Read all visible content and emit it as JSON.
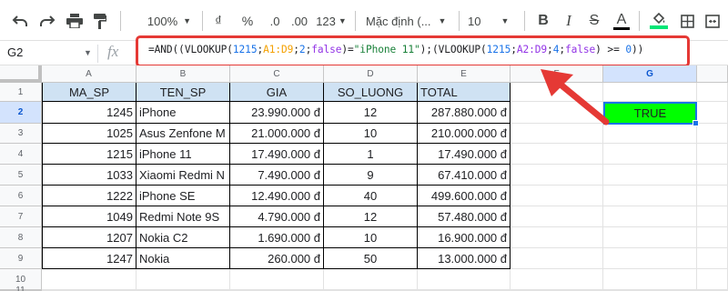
{
  "toolbar": {
    "zoom": "100%",
    "currency": "₫",
    "percent": "%",
    "decrease_decimals": ".0",
    "increase_decimals": ".00",
    "number_format": "123",
    "font": "Mặc định (...",
    "font_size": "10",
    "bold": "B",
    "italic": "I",
    "strikethrough": "S",
    "text_color": "A",
    "accent_color": "#00e676",
    "icons": [
      "undo-icon",
      "redo-icon",
      "print-icon",
      "paint-format-icon",
      "fill-color-icon",
      "borders-icon"
    ]
  },
  "formula_bar": {
    "cell_ref": "G2",
    "fx": "fx",
    "tokens": [
      {
        "t": "=AND((VLOOKUP(",
        "c": "plain"
      },
      {
        "t": "1215",
        "c": "num"
      },
      {
        "t": ";",
        "c": "plain"
      },
      {
        "t": "A1:D9",
        "c": "ref1"
      },
      {
        "t": ";",
        "c": "plain"
      },
      {
        "t": "2",
        "c": "num"
      },
      {
        "t": ";",
        "c": "plain"
      },
      {
        "t": "false",
        "c": "ref2"
      },
      {
        "t": ")=",
        "c": "plain"
      },
      {
        "t": "\"iPhone 11\"",
        "c": "str"
      },
      {
        "t": ");(VLOOKUP(",
        "c": "plain"
      },
      {
        "t": "1215",
        "c": "num"
      },
      {
        "t": ";",
        "c": "plain"
      },
      {
        "t": "A2:D9",
        "c": "ref2"
      },
      {
        "t": ";",
        "c": "plain"
      },
      {
        "t": "4",
        "c": "num"
      },
      {
        "t": ";",
        "c": "plain"
      },
      {
        "t": "false",
        "c": "ref2"
      },
      {
        "t": ") >= ",
        "c": "plain"
      },
      {
        "t": "0",
        "c": "num"
      },
      {
        "t": "))",
        "c": "plain"
      }
    ],
    "highlight_color": "#e53935"
  },
  "grid": {
    "columns": [
      "A",
      "B",
      "C",
      "D",
      "E",
      "F",
      "G"
    ],
    "rows": [
      "1",
      "2",
      "3",
      "4",
      "5",
      "6",
      "7",
      "8",
      "9",
      "10",
      "11"
    ],
    "selected_column": "G",
    "selected_row": "2",
    "header_fill": "#cfe2f3",
    "table": {
      "headers": [
        "MA_SP",
        "TEN_SP",
        "GIA",
        "SO_LUONG",
        "TOTAL"
      ],
      "rows": [
        [
          "1245",
          "iPhone",
          "23.990.000 đ",
          "12",
          "287.880.000 đ"
        ],
        [
          "1025",
          "Asus Zenfone M",
          "21.000.000 đ",
          "10",
          "210.000.000 đ"
        ],
        [
          "1215",
          "iPhone 11",
          "17.490.000 đ",
          "1",
          "17.490.000 đ"
        ],
        [
          "1033",
          "Xiaomi Redmi N",
          "7.490.000 đ",
          "9",
          "67.410.000 đ"
        ],
        [
          "1222",
          "iPhone SE",
          "12.490.000 đ",
          "40",
          "499.600.000 đ"
        ],
        [
          "1049",
          "Redmi Note 9S",
          "4.790.000 đ",
          "12",
          "57.480.000 đ"
        ],
        [
          "1207",
          "Nokia C2",
          "1.690.000 đ",
          "10",
          "16.900.000 đ"
        ],
        [
          "1247",
          "Nokia",
          "260.000 đ",
          "50",
          "13.000.000 đ"
        ]
      ]
    },
    "result_cell": {
      "value": "TRUE",
      "fill": "#00ff00"
    }
  }
}
